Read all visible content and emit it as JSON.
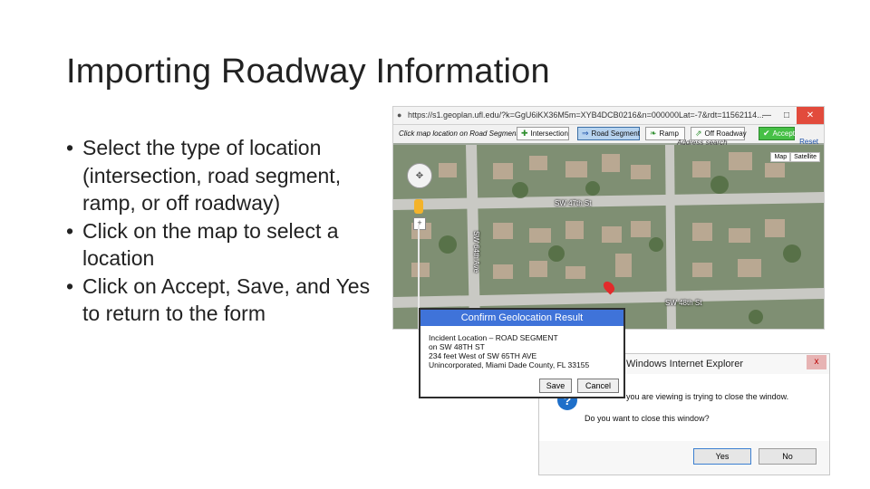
{
  "slide": {
    "title": "Importing Roadway Information",
    "bullets": [
      "Select the type of location (intersection, road segment, ramp, or off roadway)",
      "Click on the map to select a location",
      "Click on Accept, Save, and Yes to return to the form"
    ]
  },
  "browser": {
    "url": "https://s1.geoplan.ufl.edu/?k=GgU6iKX36M5m=XYB4DCB0216&n=000000Lat=-7&rdt=11562114...",
    "toolbar_label": "Click map location on Road Segment",
    "buttons": {
      "intersection": "Intersection",
      "road_segment": "Road Segment",
      "ramp": "Ramp",
      "off_roadway": "Off Roadway",
      "accept": "Accept"
    },
    "address_search": "Address search",
    "reset": "Reset",
    "map_type": {
      "map": "Map",
      "satellite": "Satellite"
    },
    "streets": {
      "s1": "SW 47th St",
      "s2": "SW 48th St",
      "s3": "SW 64th Ave"
    },
    "colors": {
      "accept": "#46c046",
      "active": "#b7d3ef",
      "dialog_header": "#3f73d9",
      "pin": "#e22b2b"
    }
  },
  "confirm_dialog": {
    "title": "Confirm Geolocation Result",
    "lines": [
      "Incident Location – ROAD SEGMENT",
      "on SW 48TH ST",
      "234 feet West of SW 65TH AVE",
      "Unincorporated, Miami Dade County, FL 33155"
    ],
    "save": "Save",
    "cancel": "Cancel"
  },
  "ie_dialog": {
    "title": "Windows Internet Explorer",
    "close": "x",
    "message": "you are viewing is trying to close the window.",
    "question": "Do you want to close this window?",
    "yes": "Yes",
    "no": "No",
    "icon": "question-icon"
  }
}
